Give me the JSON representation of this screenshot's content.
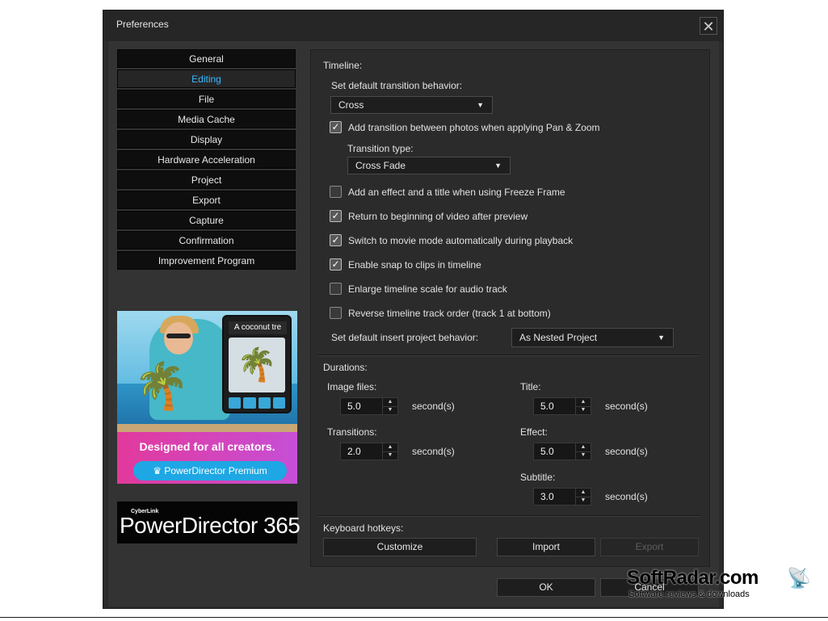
{
  "window": {
    "title": "Preferences",
    "close_glyph": "✕"
  },
  "nav": {
    "items": [
      "General",
      "Editing",
      "File",
      "Media Cache",
      "Display",
      "Hardware Acceleration",
      "Project",
      "Export",
      "Capture",
      "Confirmation",
      "Improvement Program"
    ],
    "active": "Editing"
  },
  "ad": {
    "card_label": "A coconut tre",
    "slogan": "Designed for all creators.",
    "button_label": "PowerDirector Premium",
    "crown_icon": "crown-icon",
    "palm_icon": "palm-tree-icon"
  },
  "logo": {
    "small": "CyberLink",
    "big": "PowerDirector 365"
  },
  "timeline": {
    "title": "Timeline:",
    "default_transition_label": "Set default transition behavior:",
    "default_transition_value": "Cross",
    "pan_zoom": {
      "label": "Add transition between photos when applying Pan & Zoom",
      "checked": true
    },
    "transition_type_label": "Transition type:",
    "transition_type_value": "Cross Fade",
    "options": [
      {
        "label": "Add an effect and a title when using Freeze Frame",
        "checked": false
      },
      {
        "label": "Return to beginning of video after preview",
        "checked": true
      },
      {
        "label": "Switch to movie mode automatically during playback",
        "checked": true
      },
      {
        "label": "Enable snap to clips in timeline",
        "checked": true
      },
      {
        "label": "Enlarge timeline scale for audio track",
        "checked": false
      },
      {
        "label": "Reverse timeline track order (track 1 at bottom)",
        "checked": false
      }
    ],
    "insert_label": "Set default insert project behavior:",
    "insert_value": "As Nested Project"
  },
  "durations": {
    "title": "Durations:",
    "unit": "second(s)",
    "image_files": {
      "label": "Image files:",
      "value": "5.0"
    },
    "transitions": {
      "label": "Transitions:",
      "value": "2.0"
    },
    "title_field": {
      "label": "Title:",
      "value": "5.0"
    },
    "effect": {
      "label": "Effect:",
      "value": "5.0"
    },
    "subtitle": {
      "label": "Subtitle:",
      "value": "3.0"
    }
  },
  "hotkeys": {
    "title": "Keyboard hotkeys:",
    "customize": "Customize",
    "import": "Import",
    "export": "Export"
  },
  "footer": {
    "ok": "OK",
    "cancel": "Cancel"
  },
  "watermark": {
    "big": "SoftRadar.com",
    "small": "Software reviews & downloads"
  },
  "colors": {
    "accent": "#3ab7ff",
    "panel": "#2b2b2b",
    "nav_bg": "#0e0e0e"
  }
}
